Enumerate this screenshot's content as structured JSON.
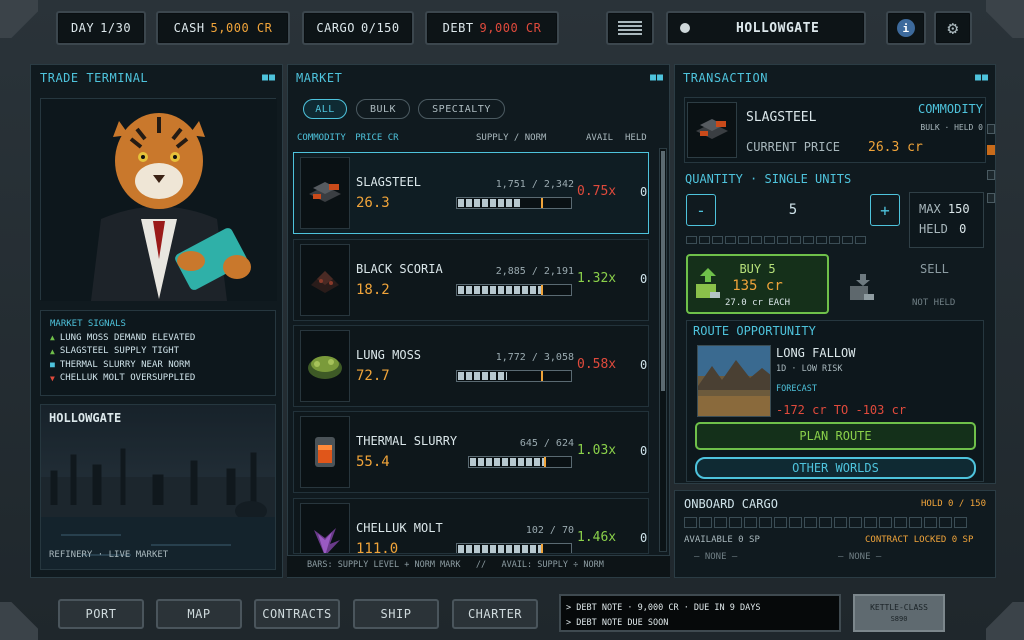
{
  "top": {
    "day_label": "DAY",
    "day_value": "1/30",
    "cash_label": "CASH",
    "cash_value": "5,000 CR",
    "cargo_label": "CARGO",
    "cargo_value": "0/150",
    "debt_label": "DEBT",
    "debt_value": "9,000 CR",
    "location": "HOLLOWGATE"
  },
  "left": {
    "title": "TRADE TERMINAL",
    "signals_title": "MARKET SIGNALS",
    "signals": [
      {
        "icon": "up-arrow",
        "color": "#6fc04a",
        "text": "LUNG MOSS DEMAND ELEVATED"
      },
      {
        "icon": "up-arrow",
        "color": "#6fc04a",
        "text": "SLAGSTEEL SUPPLY TIGHT"
      },
      {
        "icon": "square",
        "color": "#4ec3dc",
        "text": "THERMAL SLURRY NEAR NORM"
      },
      {
        "icon": "down-arrow",
        "color": "#e04a3c",
        "text": "CHELLUK MOLT OVERSUPPLIED"
      }
    ],
    "location_name": "HOLLOWGATE",
    "location_caption": "REFINERY · LIVE MARKET"
  },
  "market": {
    "title": "MARKET",
    "filters": [
      "ALL",
      "BULK",
      "SPECIALTY"
    ],
    "col_commodity": "COMMODITY",
    "col_price": "PRICE CR",
    "col_supply": "SUPPLY / NORM",
    "col_avail": "AVAIL",
    "col_held": "HELD",
    "items": [
      {
        "name": "SLAGSTEEL",
        "price": "26.3",
        "supply": "1,751 / 2,342",
        "ratio": "0.75x",
        "ratio_color": "#e04a3c",
        "held": "0",
        "fill": 0.75
      },
      {
        "name": "BLACK SCORIA",
        "price": "18.2",
        "supply": "2,885 / 2,191",
        "ratio": "1.32x",
        "ratio_color": "#8ad04a",
        "held": "0",
        "fill": 1.0
      },
      {
        "name": "LUNG MOSS",
        "price": "72.7",
        "supply": "1,772 / 3,058",
        "ratio": "0.58x",
        "ratio_color": "#e04a3c",
        "held": "0",
        "fill": 0.58
      },
      {
        "name": "THERMAL SLURRY",
        "price": "55.4",
        "supply": "645 / 624",
        "ratio": "1.03x",
        "ratio_color": "#8ad04a",
        "held": "0",
        "fill": 1.0
      },
      {
        "name": "CHELLUK MOLT",
        "price": "111.0",
        "supply": "102 / 70",
        "ratio": "1.46x",
        "ratio_color": "#8ad04a",
        "held": "0",
        "fill": 1.0
      }
    ],
    "footer": "BARS: SUPPLY LEVEL + NORM MARK   //   AVAIL: SUPPLY ÷ NORM"
  },
  "transaction": {
    "title": "TRANSACTION",
    "item_name": "SLAGSTEEL",
    "category": "COMMODITY",
    "meta": "BULK · HELD 0",
    "price_label": "CURRENT PRICE",
    "price_value": "26.3 cr",
    "quantity_label": "QUANTITY · SINGLE UNITS",
    "quantity": "5",
    "max_label": "MAX",
    "max_value": "150",
    "held_label": "HELD",
    "held_value": "0",
    "buy_label": "BUY 5",
    "buy_total": "135 cr",
    "buy_each": "27.0 cr EACH",
    "sell_label": "SELL",
    "sell_note": "NOT HELD",
    "route_title": "ROUTE OPPORTUNITY",
    "route_dest": "LONG FALLOW",
    "route_meta": "1D · LOW RISK",
    "route_forecast_label": "FORECAST",
    "route_forecast": "-172 cr TO -103 cr",
    "plan_route": "PLAN ROUTE",
    "other_worlds": "OTHER WORLDS"
  },
  "cargo": {
    "title": "ONBOARD CARGO",
    "hold": "HOLD 0 / 150",
    "available": "AVAILABLE  0 SP",
    "locked": "CONTRACT LOCKED  0 SP",
    "none_left": "— NONE —",
    "none_right": "— NONE —"
  },
  "nav": [
    "PORT",
    "MAP",
    "CONTRACTS",
    "SHIP",
    "CHARTER"
  ],
  "log": [
    "> DEBT NOTE · 9,000 CR · DUE IN 9 DAYS",
    "> DEBT NOTE DUE SOON"
  ],
  "ship": {
    "class": "KETTLE-CLASS",
    "id": "S890"
  }
}
